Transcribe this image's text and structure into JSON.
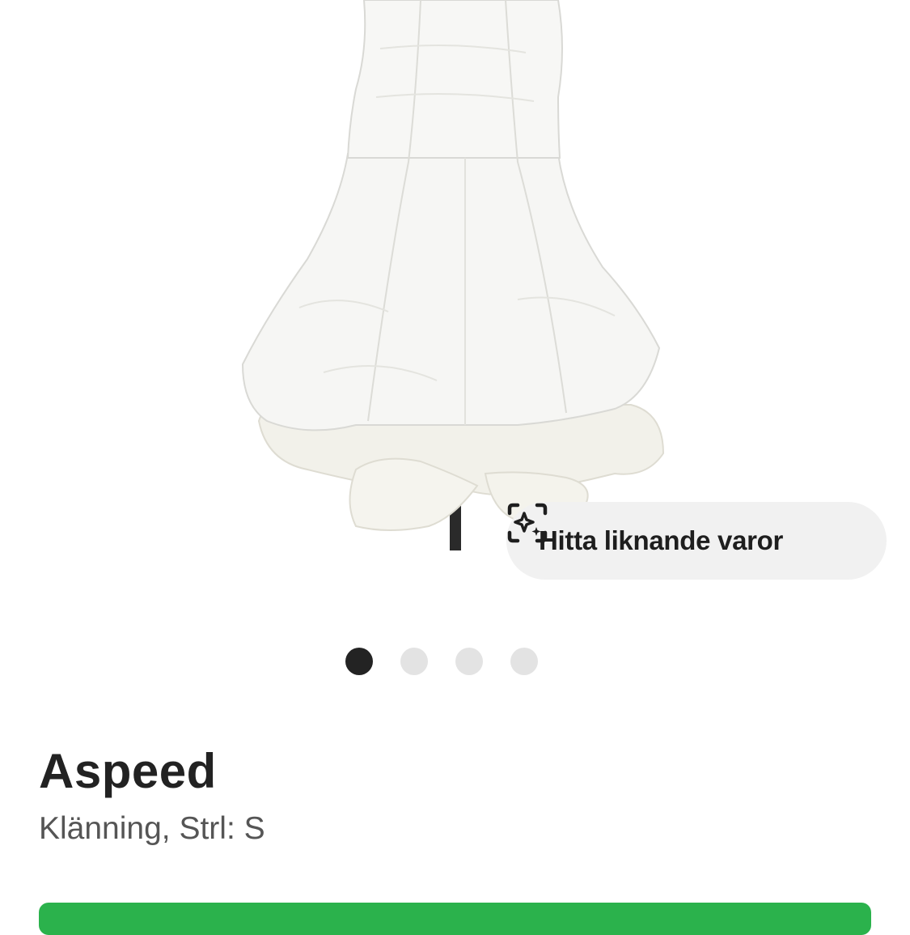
{
  "product": {
    "brand": "Aspeed",
    "subtitle": "Klänning, Strl: S"
  },
  "image_carousel": {
    "total_images": 4,
    "active_index": 0
  },
  "find_similar": {
    "label": "Hitta liknande varor",
    "icon": "visual-search-sparkle-icon"
  },
  "colors": {
    "cta_green": "#2bb24c",
    "dot_active": "#232323",
    "dot_inactive": "#e3e3e3",
    "pill_bg": "#f1f1f1"
  }
}
